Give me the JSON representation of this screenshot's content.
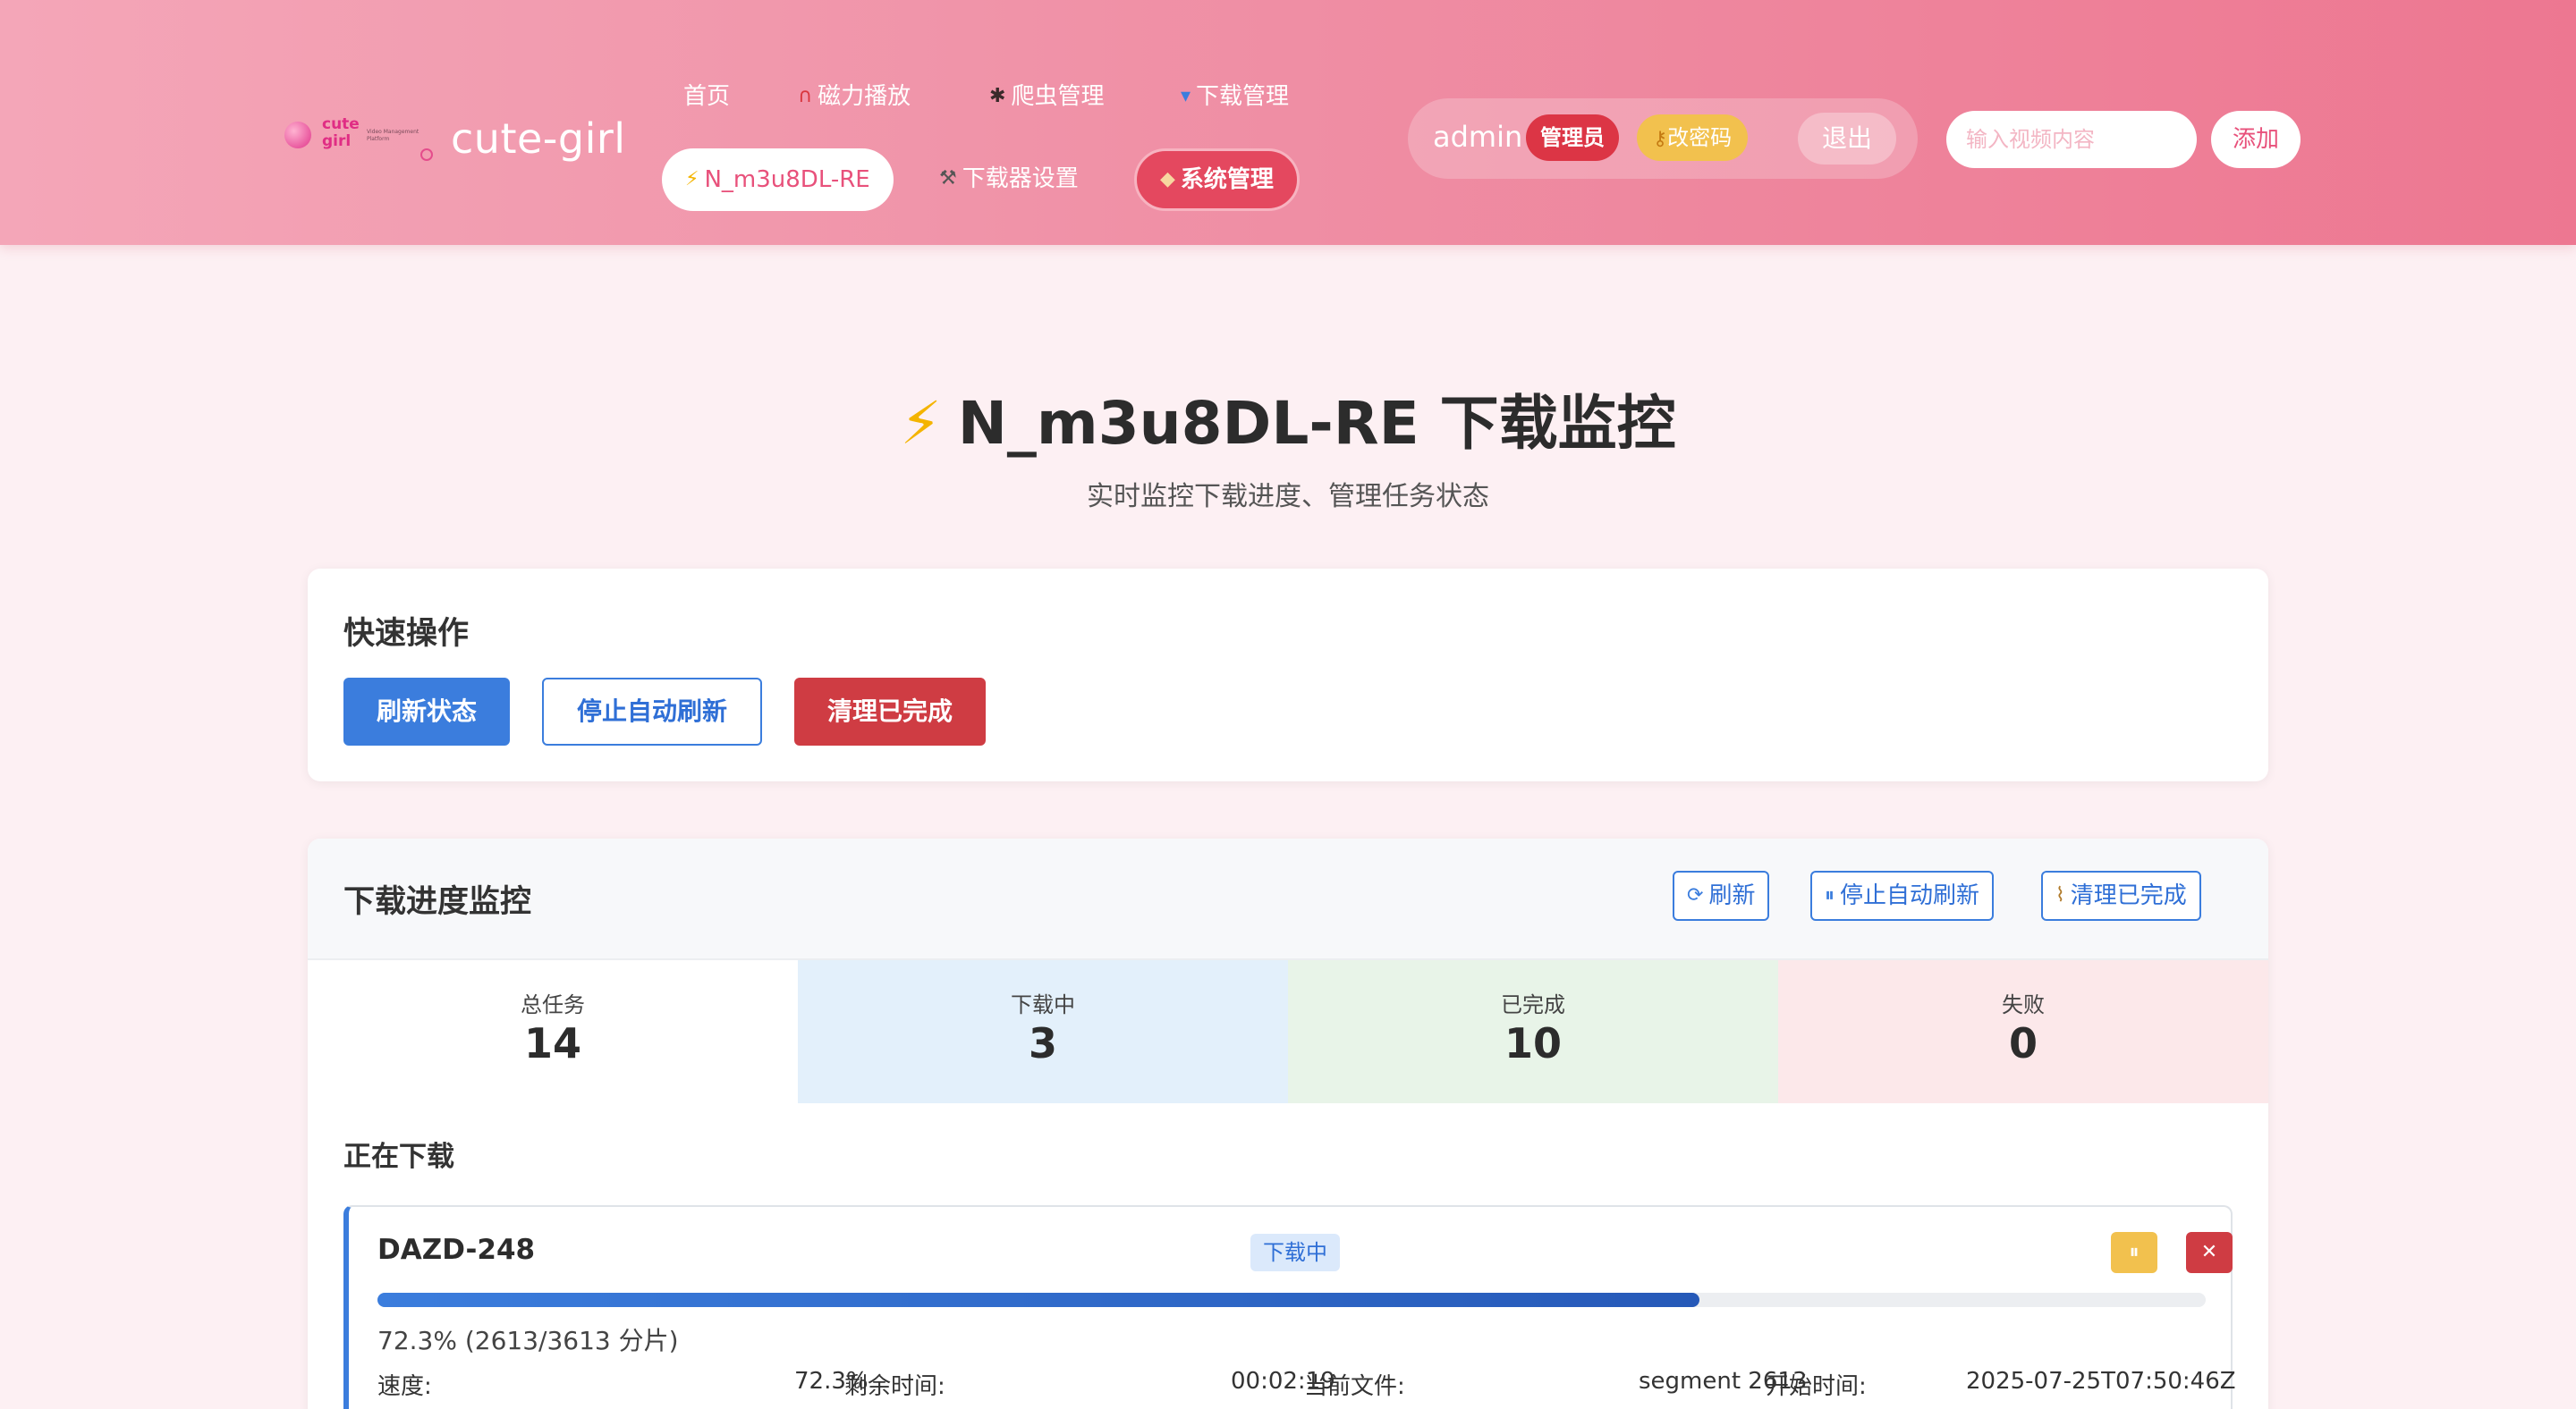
{
  "header": {
    "logo_text": "cute\ngirl",
    "logo_tagline": "Video Management Platform",
    "brand_name": "cute-girl",
    "nav": [
      {
        "label": "首页",
        "icon": ""
      },
      {
        "label": "磁力播放",
        "icon": "magnet-icon"
      },
      {
        "label": "爬虫管理",
        "icon": "spider-icon"
      },
      {
        "label": "下载管理",
        "icon": "inbox-tray-icon"
      },
      {
        "label": "N_m3u8DL-RE",
        "icon": "lightning-icon",
        "active": true
      },
      {
        "label": "下载器设置",
        "icon": "wrench-icon"
      },
      {
        "label": "系统管理",
        "icon": "shield-icon"
      }
    ],
    "user": {
      "name": "admin",
      "role_badge": "管理员",
      "change_password": "改密码",
      "logout": "退出"
    },
    "search": {
      "placeholder": "输入视频内容",
      "value": ""
    },
    "add_label": "添加"
  },
  "page": {
    "title": "N_m3u8DL-RE 下载监控",
    "title_icon": "⚡",
    "subtitle": "实时监控下载进度、管理任务状态"
  },
  "quick_actions": {
    "title": "快速操作",
    "refresh": "刷新状态",
    "stop_auto_refresh": "停止自动刷新",
    "clear_completed": "清理已完成"
  },
  "monitor": {
    "title": "下载进度监控",
    "refresh": "刷新",
    "stop_auto_refresh": "停止自动刷新",
    "clear_completed": "清理已完成",
    "stats": [
      {
        "label": "总任务",
        "value": "14",
        "color": "#ffffff"
      },
      {
        "label": "下载中",
        "value": "3",
        "color": "#e3f0fb"
      },
      {
        "label": "已完成",
        "value": "10",
        "color": "#e8f4e8"
      },
      {
        "label": "失败",
        "value": "0",
        "color": "#fce8ea"
      }
    ],
    "active_section_title": "正在下载",
    "tasks": [
      {
        "name": "DAZD-248",
        "status": "下载中",
        "progress": 0.723,
        "progress_text": "72.3% (2613/3613 分片)",
        "speed_label": "速度:",
        "speed_value": "72.3%",
        "remaining_label": "剩余时间:",
        "remaining_value": "00:02:19",
        "current_file_label": "当前文件:",
        "current_file_value": "segment 2613",
        "start_time_label": "开始时间:",
        "start_time_value": "2025-07-25T07:50:46Z"
      }
    ]
  },
  "colors": {
    "header_gradient_start": "#f4a6b8",
    "header_gradient_end": "#ed7791",
    "primary": "#3b7ddd",
    "danger": "#cf3c43",
    "warning": "#f2c14e"
  }
}
